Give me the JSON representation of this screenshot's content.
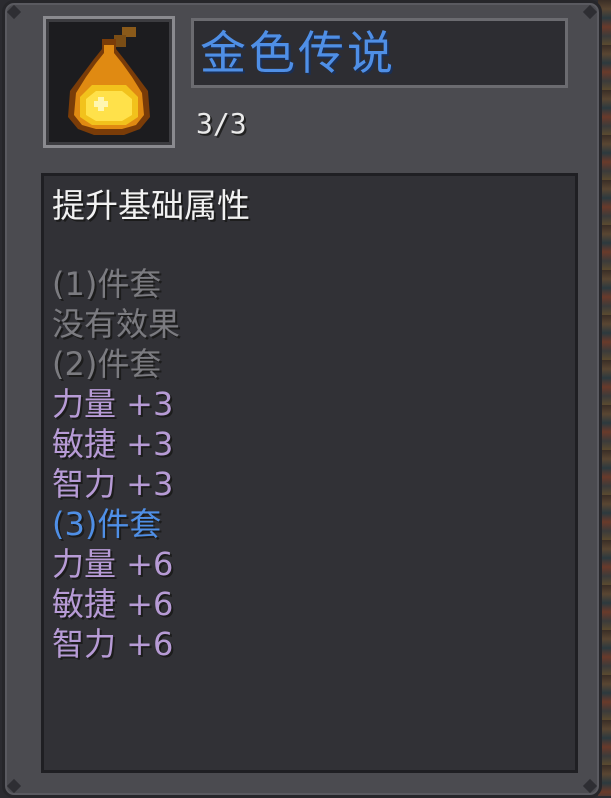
{
  "item": {
    "name": "金色传说",
    "count": "3/3",
    "icon": "golden-pear-fruit-icon",
    "name_color": "#4f8fe6"
  },
  "description": {
    "title": "提升基础属性",
    "lines": [
      {
        "text": "(1)件套",
        "color": "#7b7b80"
      },
      {
        "text": "没有效果",
        "color": "#7b7b80"
      },
      {
        "text": "(2)件套",
        "color": "#7b7b80"
      },
      {
        "text": "力量 +3",
        "color": "#b79bd6"
      },
      {
        "text": "敏捷 +3",
        "color": "#b79bd6"
      },
      {
        "text": "智力 +3",
        "color": "#b79bd6"
      },
      {
        "text": "(3)件套",
        "color": "#4f8fe6"
      },
      {
        "text": "力量 +6",
        "color": "#b79bd6"
      },
      {
        "text": "敏捷 +6",
        "color": "#b79bd6"
      },
      {
        "text": "智力 +6",
        "color": "#b79bd6"
      }
    ]
  }
}
